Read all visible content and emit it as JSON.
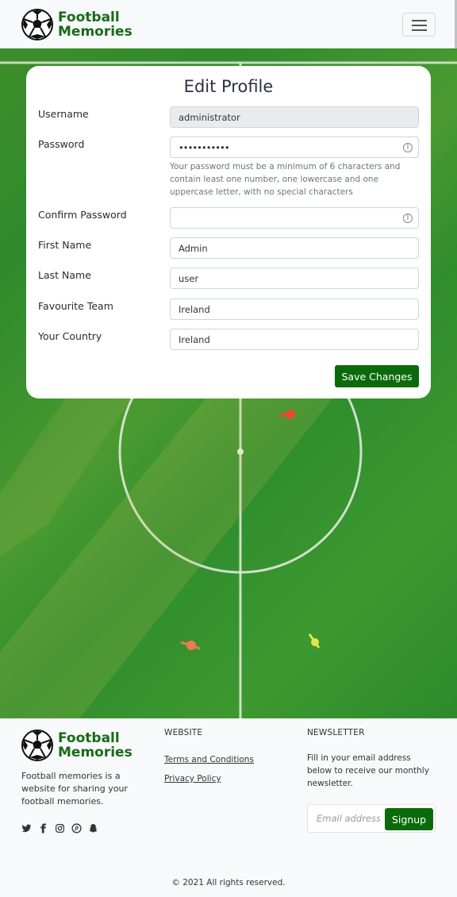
{
  "brand": {
    "line1": "Football",
    "line2": "Memories"
  },
  "form": {
    "title": "Edit Profile",
    "username": {
      "label": "Username",
      "value": "administrator"
    },
    "password": {
      "label": "Password",
      "value": "•••••••••••"
    },
    "password_help": "Your password must be a minimum of 6 characters and contain least one number, one lowercase and one uppercase letter, with no special characters",
    "confirm_password": {
      "label": "Confirm Password",
      "value": ""
    },
    "first_name": {
      "label": "First Name",
      "value": "Admin"
    },
    "last_name": {
      "label": "Last Name",
      "value": "user"
    },
    "favourite_team": {
      "label": "Favourite Team",
      "value": "Ireland"
    },
    "country": {
      "label": "Your Country",
      "value": "Ireland"
    },
    "save_label": "Save Changes"
  },
  "footer": {
    "description": "Football memories is a website for sharing your football memories.",
    "website_heading": "WEBSITE",
    "links": [
      "Terms and Conditions",
      "Privacy Policy"
    ],
    "newsletter_heading": "NEWSLETTER",
    "newsletter_text": "Fill in your email address below to receive our monthly newsletter.",
    "email_placeholder": "Email address",
    "signup_label": "Signup",
    "copyright": "© 2021 All rights reserved.",
    "social_icons": [
      "twitter-icon",
      "facebook-icon",
      "instagram-icon",
      "pinterest-icon",
      "snapchat-icon"
    ]
  },
  "colors": {
    "brand_green": "#176b17",
    "button_green": "#0b6b0b",
    "field_green": "#2f8a2c"
  }
}
